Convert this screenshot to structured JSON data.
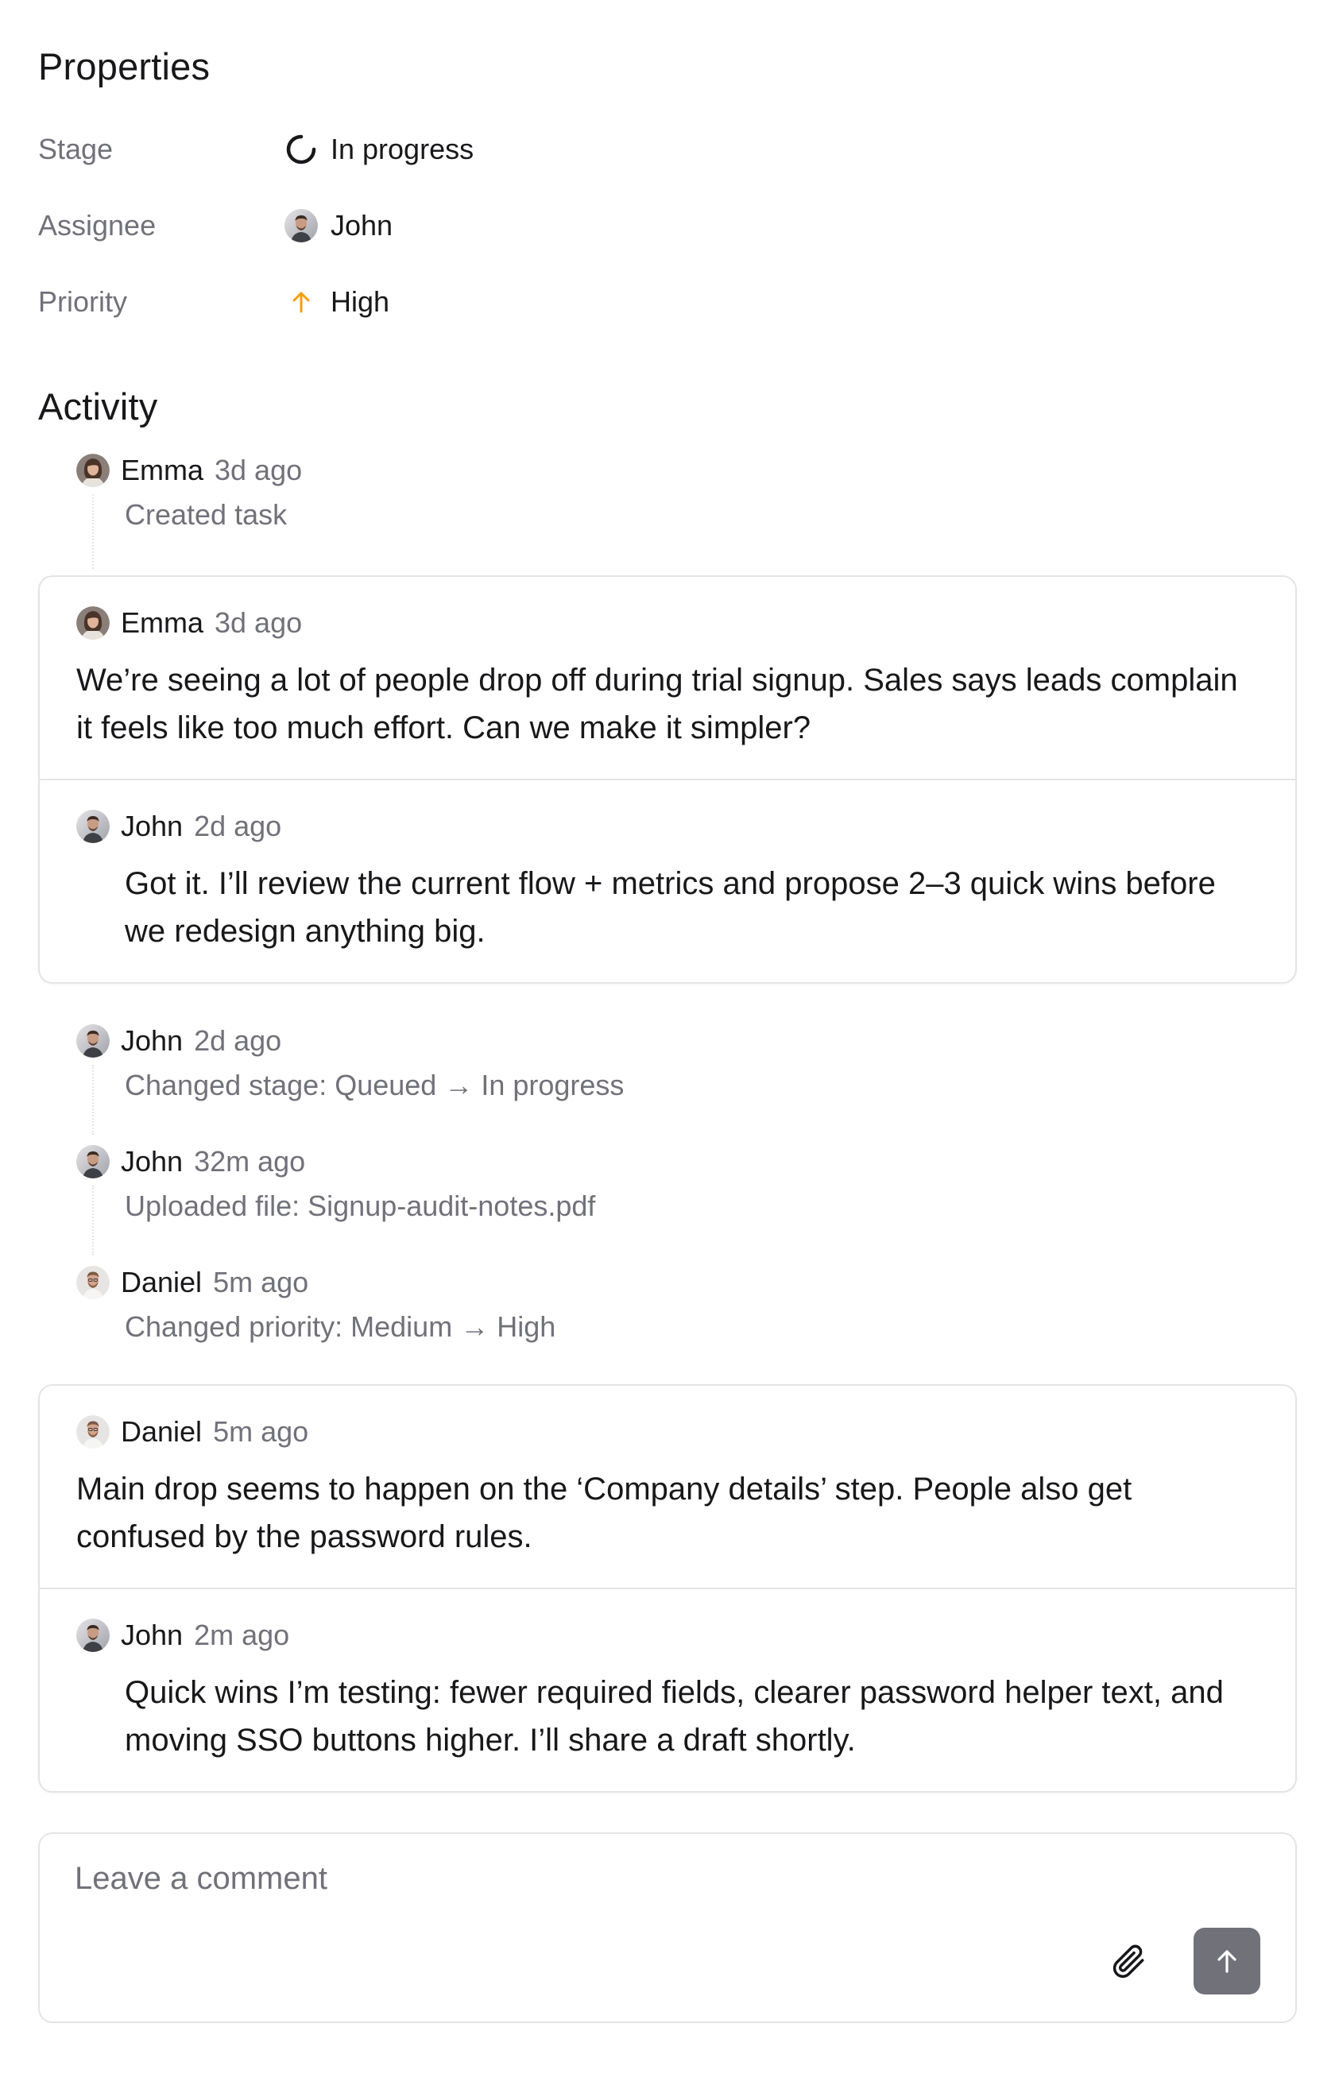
{
  "properties": {
    "title": "Properties",
    "rows": [
      {
        "label": "Stage",
        "value": "In progress",
        "icon": "progress-spinner-icon"
      },
      {
        "label": "Assignee",
        "value": "John",
        "icon": "avatar-john"
      },
      {
        "label": "Priority",
        "value": "High",
        "icon": "arrow-up-icon",
        "icon_color": "#f59e0b"
      }
    ]
  },
  "activity": {
    "title": "Activity",
    "events_top": [
      {
        "name": "Emma",
        "time": "3d ago",
        "text": "Created task"
      }
    ],
    "thread1": {
      "comment": {
        "name": "Emma",
        "time": "3d ago",
        "text": "We’re seeing a lot of people drop off during trial signup. Sales says leads complain it feels like too much effort. Can we make it simpler?"
      },
      "reply": {
        "name": "John",
        "time": "2d ago",
        "text": "Got it. I’ll review the current flow + metrics and propose 2–3 quick wins before we redesign anything big."
      }
    },
    "events_middle": [
      {
        "name": "John",
        "time": "2d ago",
        "text": "Changed stage: Queued → In progress"
      },
      {
        "name": "John",
        "time": "32m ago",
        "text": "Uploaded file: Signup-audit-notes.pdf"
      },
      {
        "name": "Daniel",
        "time": "5m ago",
        "text": "Changed priority: Medium → High"
      }
    ],
    "thread2": {
      "comment": {
        "name": "Daniel",
        "time": "5m ago",
        "text": "Main drop seems to happen on the ‘Company details’ step. People also get confused by the password rules."
      },
      "reply": {
        "name": "John",
        "time": "2m ago",
        "text": "Quick wins I’m testing: fewer required fields, clearer password helper text, and moving SSO buttons higher. I’ll share a draft shortly."
      }
    }
  },
  "comment_box": {
    "placeholder": "Leave a comment",
    "value": ""
  },
  "colors": {
    "muted_text": "#71717a",
    "border": "#e4e4e7",
    "priority_high": "#f59e0b",
    "send_button": "#71717a"
  }
}
